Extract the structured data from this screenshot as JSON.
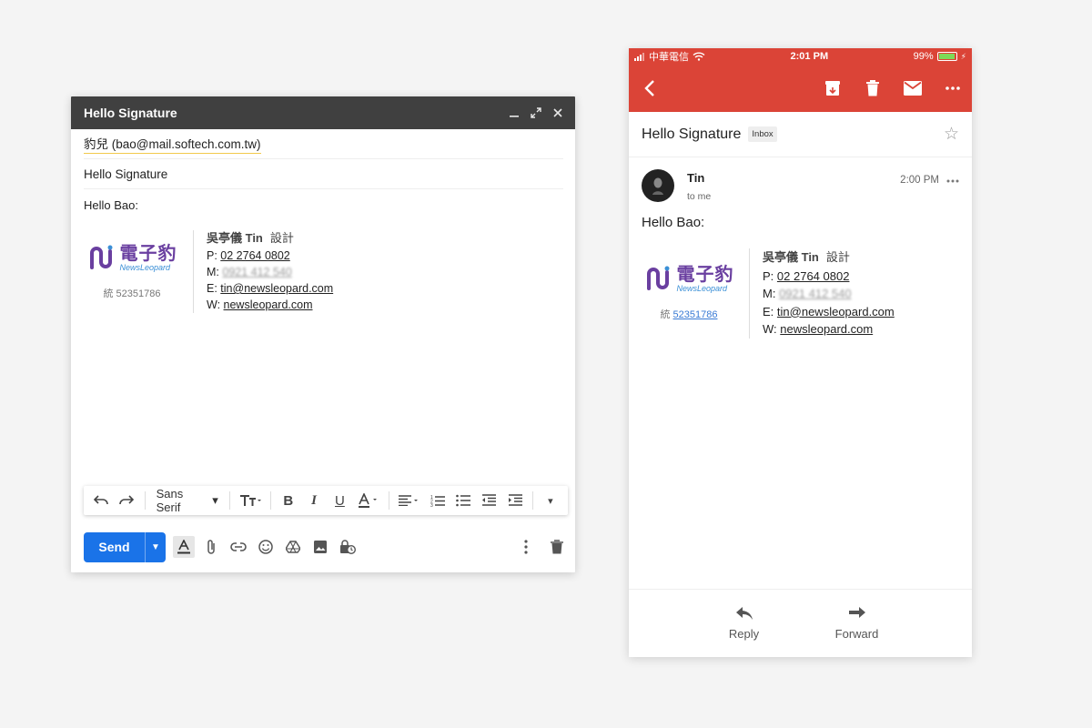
{
  "compose": {
    "title": "Hello Signature",
    "to": "豹兒 (bao@mail.softech.com.tw)",
    "subject": "Hello Signature",
    "greeting": "Hello Bao:",
    "font_select": "Sans Serif",
    "send_label": "Send"
  },
  "signature": {
    "name": "吳亭儀 Tin",
    "role": "設計",
    "phone_label": "P:",
    "phone": "02 2764 0802",
    "mobile_label": "M:",
    "mobile": "0921 412 540",
    "email_label": "E:",
    "email": "tin@newsleopard.com",
    "web_label": "W:",
    "web": "newsleopard.com",
    "logo_cn": "電子豹",
    "logo_en": "NewsLeopard",
    "tax_prefix": "統",
    "tax_id": "52351786"
  },
  "phone": {
    "carrier": "中華電信",
    "time": "2:01 PM",
    "battery": "99%",
    "battery_level": 0.99,
    "subject": "Hello Signature",
    "inbox_tag": "Inbox",
    "sender": "Tin",
    "to_me": "to me",
    "sent_time": "2:00 PM",
    "greeting": "Hello Bao:",
    "reply_label": "Reply",
    "forward_label": "Forward"
  },
  "colors": {
    "gmail_red": "#db4437",
    "send_blue": "#1a73e8",
    "header_dark": "#404040"
  },
  "icons": {
    "compose_window": [
      "minimize-icon",
      "expand-icon",
      "close-icon"
    ],
    "toolbar": [
      "undo-icon",
      "redo-icon",
      "text-size-icon",
      "bold-icon",
      "italic-icon",
      "underline-icon",
      "text-color-icon",
      "align-icon",
      "numbered-list-icon",
      "bulleted-list-icon",
      "indent-less-icon",
      "indent-more-icon",
      "more-formatting-icon"
    ],
    "bottom": [
      "formatting-icon",
      "attach-icon",
      "link-icon",
      "emoji-icon",
      "drive-icon",
      "photo-icon",
      "confidential-icon",
      "more-options-icon",
      "trash-icon"
    ],
    "phone_app_bar": [
      "back-icon",
      "archive-icon",
      "delete-icon",
      "mail-icon",
      "more-icon"
    ]
  }
}
